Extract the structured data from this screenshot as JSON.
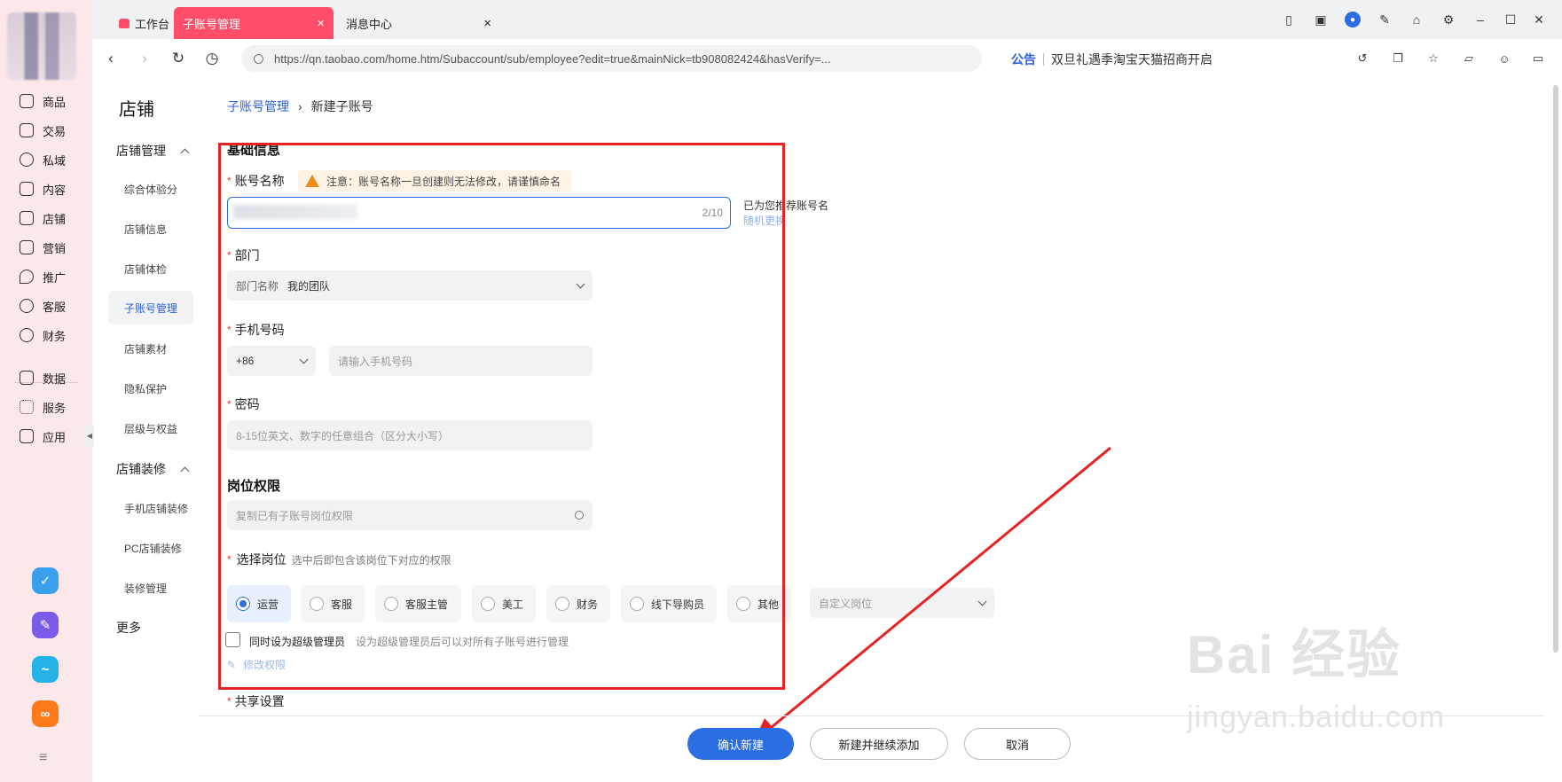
{
  "tabs": [
    {
      "label": "工作台"
    },
    {
      "label": "子账号管理",
      "close": "×"
    },
    {
      "label": "消息中心",
      "close": "×"
    }
  ],
  "window": {
    "minimize": "–",
    "maximize": "☐",
    "close": "✕"
  },
  "address": {
    "url": "https://qn.taobao.com/home.htm/Subaccount/sub/employee?edit=true&mainNick=tb908082424&hasVerify=...",
    "announce_tag": "公告",
    "announce_text": "双旦礼遇季淘宝天猫招商开启"
  },
  "rail": {
    "items": [
      {
        "label": "商品",
        "icon": "goods-icon"
      },
      {
        "label": "交易",
        "icon": "trade-icon"
      },
      {
        "label": "私域",
        "icon": "private-domain-icon"
      },
      {
        "label": "内容",
        "icon": "content-icon"
      },
      {
        "label": "店铺",
        "icon": "store-icon"
      },
      {
        "label": "营销",
        "icon": "marketing-icon"
      },
      {
        "label": "推广",
        "icon": "promotion-icon"
      },
      {
        "label": "客服",
        "icon": "customer-service-icon"
      },
      {
        "label": "财务",
        "icon": "finance-icon"
      },
      {
        "label": "数据",
        "icon": "data-icon"
      },
      {
        "label": "服务",
        "icon": "service-icon"
      },
      {
        "label": "应用",
        "icon": "apps-icon"
      }
    ],
    "apps": [
      {
        "icon": "app-task-icon",
        "color": "#3aa0ee"
      },
      {
        "icon": "app-note-icon",
        "color": "#7b5ce8"
      },
      {
        "icon": "app-wave-icon",
        "color": "#25b2e6"
      },
      {
        "icon": "app-link-icon",
        "color": "#ff7a1a"
      }
    ],
    "menu_glyph": "≡"
  },
  "sidebar": {
    "title": "店铺",
    "group1": "店铺管理",
    "group1_items": [
      "综合体验分",
      "店铺信息",
      "店铺体检",
      "子账号管理",
      "店铺素材",
      "隐私保护",
      "层级与权益"
    ],
    "group2": "店铺装修",
    "group2_items": [
      "手机店铺装修",
      "PC店铺装修",
      "装修管理"
    ],
    "more": "更多"
  },
  "breadcrumb": {
    "parent": "子账号管理",
    "sep": "›",
    "current": "新建子账号"
  },
  "form": {
    "basic_title": "基础信息",
    "req": "*",
    "account_label": "账号名称",
    "warning": "注意：账号名称一旦创建则无法修改，请谨慎命名",
    "account_count": "2/10",
    "suggest_text": "已为您推荐账号名",
    "suggest_link": "随机更换",
    "dept_label": "部门",
    "dept_prefix": "部门名称",
    "dept_value": "我的团队",
    "phone_label": "手机号码",
    "phone_code": "+86",
    "phone_placeholder": "请输入手机号码",
    "password_label": "密码",
    "password_placeholder": "8-15位英文、数字的任意组合（区分大小写）",
    "perm_title": "岗位权限",
    "perm_placeholder": "复制已有子账号岗位权限",
    "role_label": "选择岗位",
    "role_hint": "选中后即包含该岗位下对应的权限",
    "roles": [
      "运营",
      "客服",
      "客服主管",
      "美工",
      "财务",
      "线下导购员",
      "其他"
    ],
    "custom_role_placeholder": "自定义岗位",
    "super_admin_label": "同时设为超级管理员",
    "super_admin_hint": "设为超级管理员后可以对所有子账号进行管理",
    "edit_perm": "修改权限",
    "share_label": "共享设置"
  },
  "footer": {
    "confirm": "确认新建",
    "create_continue": "新建并继续添加",
    "cancel": "取消"
  },
  "watermark": {
    "brand": "Bai 经验",
    "domain": "jingyan.baidu.com"
  },
  "colors": {
    "accent": "#2b6de3",
    "tab_active": "#ff4d6a",
    "annotation": "#e62222"
  }
}
